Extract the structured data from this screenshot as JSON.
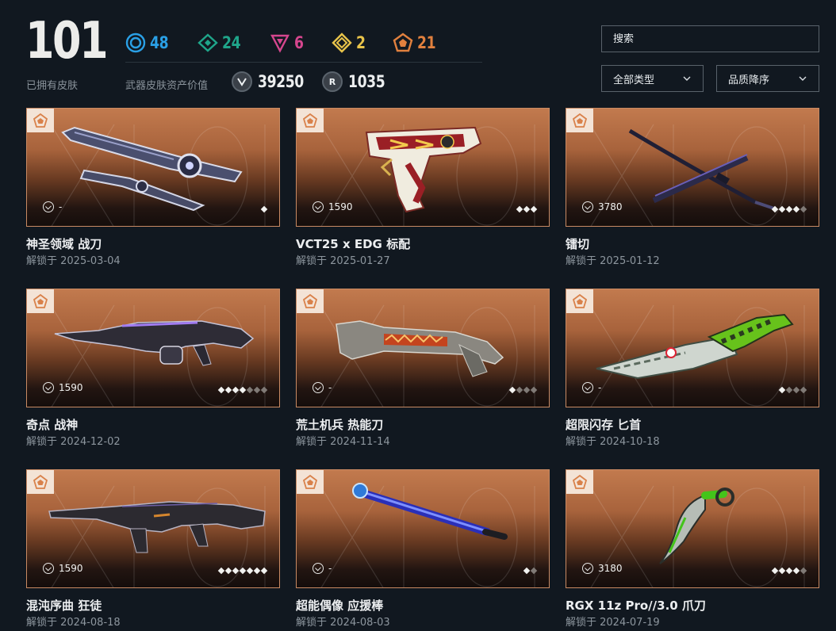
{
  "summary": {
    "owned_count": "101",
    "owned_label": "已拥有皮肤",
    "tiers": [
      {
        "icon": "select-tier-icon",
        "count": "48",
        "color": "#2aa0e6"
      },
      {
        "icon": "deluxe-tier-icon",
        "count": "24",
        "color": "#1fa58a"
      },
      {
        "icon": "premium-tier-icon",
        "count": "6",
        "color": "#d6468e"
      },
      {
        "icon": "exclusive-tier-icon",
        "count": "2",
        "color": "#e8c34a"
      },
      {
        "icon": "ultra-tier-icon",
        "count": "21",
        "color": "#e1803e"
      }
    ],
    "asset_label": "武器皮肤资产价值",
    "vp_value": "39250",
    "radianite_value": "1035",
    "radianite_symbol": "R"
  },
  "controls": {
    "search_placeholder": "搜索",
    "type_filter": "全部类型",
    "sort_filter": "品质降序"
  },
  "cards": [
    {
      "name": "神圣领域 战刀",
      "date": "解锁于 2025-03-04",
      "price": "-",
      "level": 1,
      "level_max": 1,
      "weapon": "sword"
    },
    {
      "name": "VCT25 x EDG 标配",
      "date": "解锁于 2025-01-27",
      "price": "1590",
      "level": 3,
      "level_max": 3,
      "weapon": "pistol"
    },
    {
      "name": "镭切",
      "date": "解锁于 2025-01-12",
      "price": "3780",
      "level": 4,
      "level_max": 5,
      "weapon": "katana"
    },
    {
      "name": "奇点 战神",
      "date": "解锁于 2024-12-02",
      "price": "1590",
      "level": 4,
      "level_max": 7,
      "weapon": "lmg"
    },
    {
      "name": "荒土机兵 热能刀",
      "date": "解锁于 2024-11-14",
      "price": "-",
      "level": 1,
      "level_max": 4,
      "weapon": "heatblade"
    },
    {
      "name": "超限闪存 匕首",
      "date": "解锁于 2024-10-18",
      "price": "-",
      "level": 1,
      "level_max": 4,
      "weapon": "dagger"
    },
    {
      "name": "混沌序曲 狂徒",
      "date": "解锁于 2024-08-18",
      "price": "1590",
      "level": 7,
      "level_max": 7,
      "weapon": "rifle"
    },
    {
      "name": "超能偶像 应援棒",
      "date": "解锁于 2024-08-03",
      "price": "-",
      "level": 1,
      "level_max": 2,
      "weapon": "baton"
    },
    {
      "name": "RGX 11z Pro//3.0 爪刀",
      "date": "解锁于 2024-07-19",
      "price": "3180",
      "level": 4,
      "level_max": 5,
      "weapon": "karambit"
    }
  ]
}
